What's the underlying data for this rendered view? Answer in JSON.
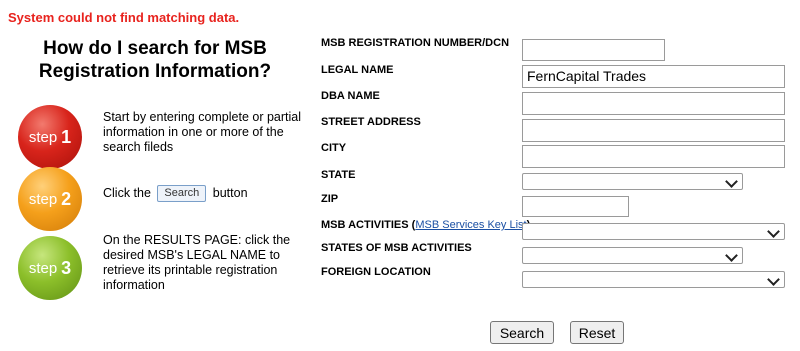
{
  "error_message": "System could not find matching data.",
  "heading": {
    "line1": "How do I search for MSB",
    "line2": "Registration Information?"
  },
  "steps": [
    {
      "badge_word": "step",
      "badge_number": "1",
      "text": "Start by entering complete or partial information in one or more of the search fileds",
      "color": "#d8241b"
    },
    {
      "badge_word": "step",
      "badge_number": "2",
      "text_before": "Click the",
      "inline_button": "Search",
      "text_after": "button",
      "color": "#f5a01b"
    },
    {
      "badge_word": "step",
      "badge_number": "3",
      "text": "On the RESULTS PAGE: click the desired MSB's LEGAL NAME to retrieve its printable registration information",
      "color": "#8cbf2a"
    }
  ],
  "form": {
    "msb_reg_label": "MSB REGISTRATION NUMBER/DCN",
    "msb_reg_value": "",
    "legal_name_label": "LEGAL NAME",
    "legal_name_value": "FernCapital Trades",
    "dba_label": "DBA NAME",
    "dba_value": "",
    "street_label": "STREET ADDRESS",
    "street_value": "",
    "city_label": "CITY",
    "city_value": "",
    "state_label": "STATE",
    "state_value": "",
    "zip_label": "ZIP",
    "zip_value": "",
    "activities_label": "MSB ACTIVITIES",
    "activities_link": "MSB Services Key List",
    "activities_value": "",
    "states_activities_label": "STATES OF MSB ACTIVITIES",
    "states_activities_value": "",
    "foreign_label": "FOREIGN LOCATION",
    "foreign_value": ""
  },
  "buttons": {
    "search": "Search",
    "reset": "Reset"
  }
}
